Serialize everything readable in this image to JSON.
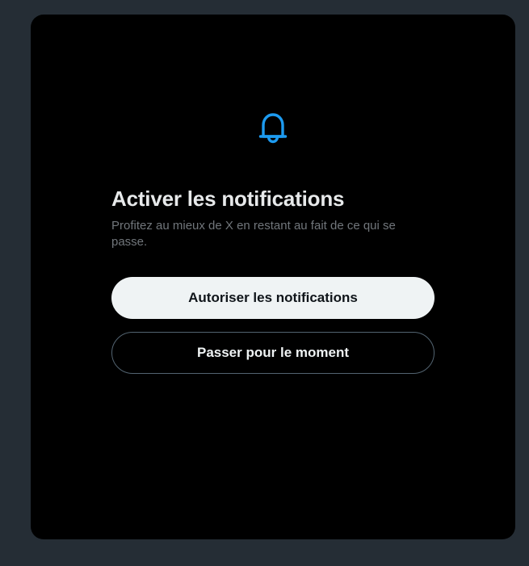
{
  "dialog": {
    "icon": "bell-icon",
    "title": "Activer les notifications",
    "subtitle": "Profitez au mieux de X en restant au fait de ce qui se passe.",
    "primary_label": "Autoriser les notifications",
    "secondary_label": "Passer pour le moment"
  },
  "colors": {
    "accent": "#1d9bf0",
    "background": "#000000",
    "backdrop": "#252d35",
    "primary_button_bg": "#eff3f4"
  }
}
